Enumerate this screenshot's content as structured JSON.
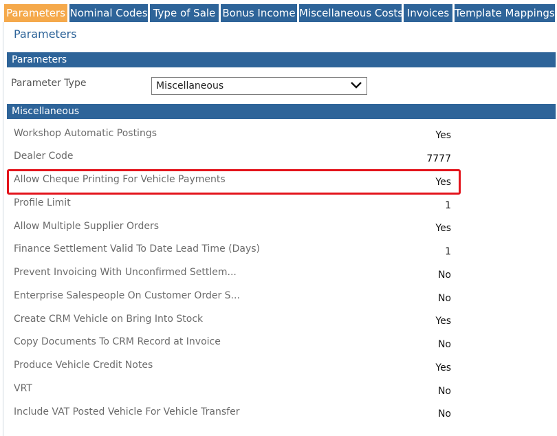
{
  "tabs": [
    {
      "label": "Parameters",
      "active": true
    },
    {
      "label": "Nominal Codes",
      "active": false
    },
    {
      "label": "Type of Sale",
      "active": false
    },
    {
      "label": "Bonus Income",
      "active": false
    },
    {
      "label": "Miscellaneous Costs",
      "active": false
    },
    {
      "label": "Invoices",
      "active": false
    },
    {
      "label": "Template Mappings",
      "active": false
    }
  ],
  "page_title": "Parameters",
  "parameters_section": {
    "header": "Parameters",
    "param_type_label": "Parameter Type",
    "param_type_value": "Miscellaneous"
  },
  "misc_section": {
    "header": "Miscellaneous",
    "rows": [
      {
        "label": "Workshop Automatic Postings",
        "value": "Yes"
      },
      {
        "label": "Dealer Code",
        "value": "7777"
      },
      {
        "label": "Allow Cheque Printing For Vehicle Payments",
        "value": "Yes"
      },
      {
        "label": "Profile Limit",
        "value": "1"
      },
      {
        "label": "Allow Multiple Supplier Orders",
        "value": "Yes"
      },
      {
        "label": "Finance Settlement Valid To Date Lead Time (Days)",
        "value": "1"
      },
      {
        "label": "Prevent Invoicing With Unconfirmed Settlem...",
        "value": "No"
      },
      {
        "label": "Enterprise Salespeople On Customer Order S...",
        "value": "No"
      },
      {
        "label": "Create CRM Vehicle on Bring Into Stock",
        "value": "Yes"
      },
      {
        "label": "Copy Documents To CRM Record at Invoice",
        "value": "No"
      },
      {
        "label": "Produce Vehicle Credit Notes",
        "value": "Yes"
      },
      {
        "label": "VRT",
        "value": "No"
      },
      {
        "label": "Include VAT Posted Vehicle For Vehicle Transfer",
        "value": "No"
      }
    ]
  },
  "colors": {
    "tab_bg": "#2e6499",
    "tab_active_bg": "#f5a94b",
    "highlight_border": "#e3131b"
  }
}
